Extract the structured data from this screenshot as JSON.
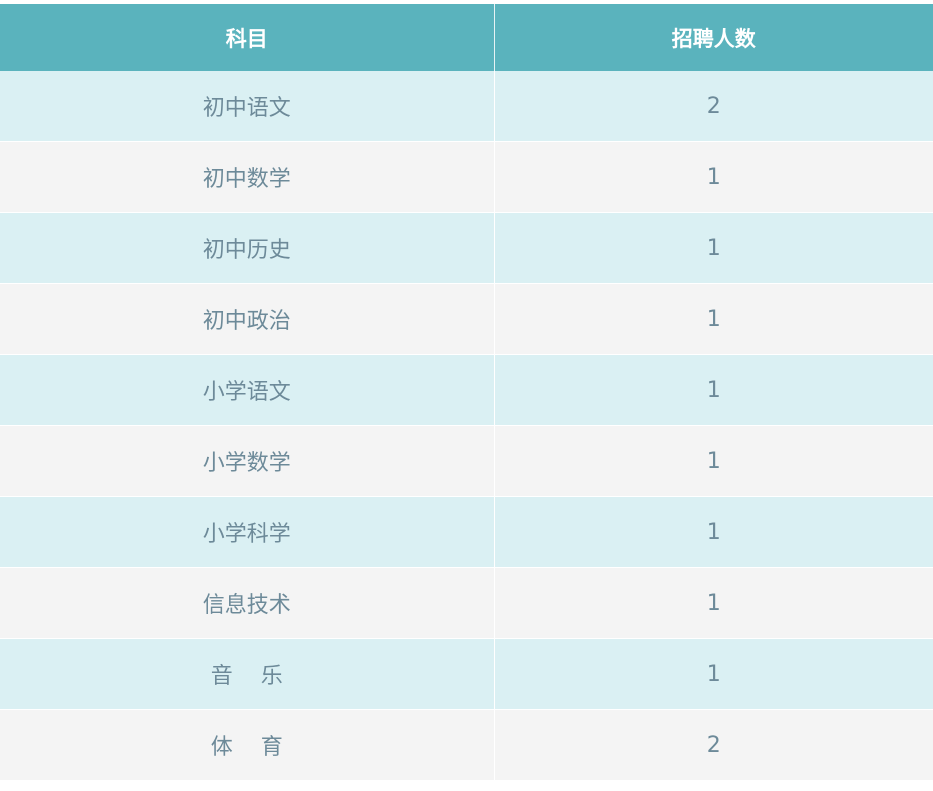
{
  "table": {
    "headers": [
      "科目",
      "招聘人数"
    ],
    "rows": [
      {
        "subject": "初中语文",
        "count": "2"
      },
      {
        "subject": "初中数学",
        "count": "1"
      },
      {
        "subject": "初中历史",
        "count": "1"
      },
      {
        "subject": "初中政治",
        "count": "1"
      },
      {
        "subject": "小学语文",
        "count": "1"
      },
      {
        "subject": "小学数学",
        "count": "1"
      },
      {
        "subject": "小学科学",
        "count": "1"
      },
      {
        "subject": "信息技术",
        "count": "1"
      },
      {
        "subject": "音    乐",
        "count": "1"
      },
      {
        "subject": "体    育",
        "count": "2"
      }
    ]
  },
  "colors": {
    "header_bg": "#5ab3bd",
    "row_alt_bg": "#daf0f3",
    "row_bg": "#f4f4f4",
    "text": "#6d8a99"
  }
}
